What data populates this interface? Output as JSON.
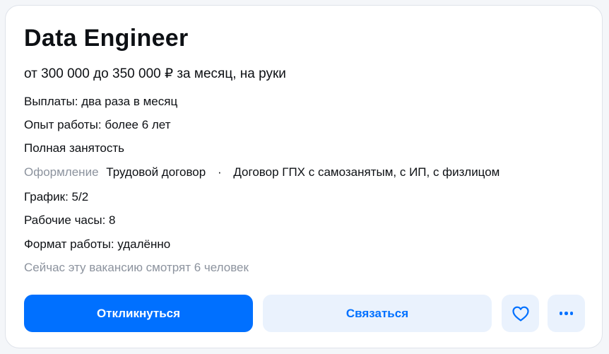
{
  "vacancy": {
    "title": "Data Engineer",
    "salary": "от 300 000 до 350 000 ₽ за месяц, на руки",
    "payments": "Выплаты: два раза в месяц",
    "experience": "Опыт работы: более 6 лет",
    "employment": "Полная занятость",
    "registration": {
      "label": "Оформление",
      "options": [
        "Трудовой договор",
        "Договор ГПХ с самозанятым, с ИП, с физлицом"
      ],
      "separator": "·"
    },
    "schedule": "График: 5/2",
    "hours": "Рабочие часы: 8",
    "work_format": "Формат работы: удалённо",
    "viewers": "Сейчас эту вакансию смотрят 6 человек"
  },
  "actions": {
    "apply_label": "Откликнуться",
    "contact_label": "Связаться",
    "favorite_icon": "heart-icon",
    "more_icon": "more-dots-icon"
  },
  "colors": {
    "accent": "#0070ff",
    "accent_light": "#eaf2fd",
    "muted_text": "#8c939e",
    "text": "#0d1014"
  }
}
